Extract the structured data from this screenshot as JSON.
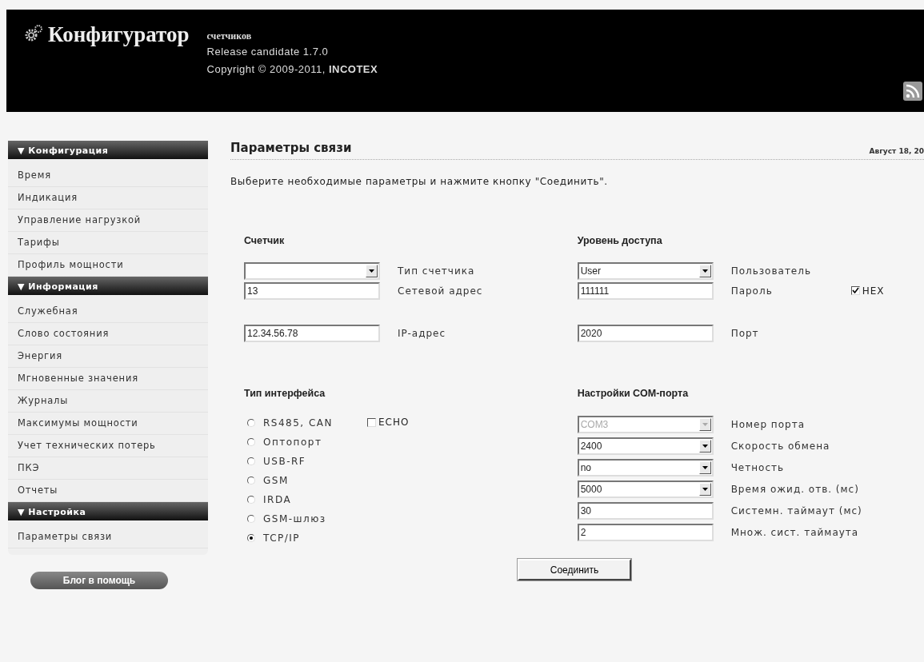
{
  "header": {
    "title": "Конфигуратор",
    "subtitle": "счетчиков",
    "release": "Release candidate 1.7.0",
    "copyright": "Copyright © 2009-2011, **INCOTEX**"
  },
  "sidebar": {
    "sections": [
      {
        "title": "▼ Конфигурация",
        "items": [
          "Время",
          "Индикация",
          "Управление нагрузкой",
          "Тарифы",
          "Профиль мощности"
        ]
      },
      {
        "title": "▼ Информация",
        "items": [
          "Служебная",
          "Слово состояния",
          "Энергия",
          "Мгновенные значения",
          "Журналы",
          "Максимумы мощности",
          "Учет технических потерь",
          "ПКЭ",
          "Отчеты"
        ]
      },
      {
        "title": "▼ Настройка",
        "items": [
          "Параметры связи"
        ]
      }
    ]
  },
  "blog_button": "Блог в помощь",
  "page": {
    "title": "Параметры связи",
    "date": "Август 18, 20",
    "instruction": "Выберите необходимые параметры и нажмите кнопку \"Соединить\"."
  },
  "meter": {
    "title": "Счетчик",
    "fields": [
      {
        "kind": "select",
        "label": "Тип счетчика"
      },
      {
        "kind": "input",
        "value": "13",
        "label": "Сетевой адрес"
      },
      {
        "kind": "input",
        "value": "12.34.56.78",
        "label": "IP-адрес"
      }
    ]
  },
  "access": {
    "title": "Уровень доступа",
    "fields": [
      {
        "kind": "select",
        "value": "User",
        "label": "Пользователь"
      },
      {
        "kind": "input",
        "value": "111111",
        "label": "Пароль"
      },
      {
        "kind": "input",
        "value": "2020",
        "label": "Порт"
      }
    ],
    "hex": {
      "label": "HEX",
      "checked": true
    }
  },
  "interface": {
    "title": "Тип интерфейса",
    "options": [
      {
        "label": "RS485, CAN",
        "selected": false
      },
      {
        "label": "Оптопорт",
        "selected": false
      },
      {
        "label": "USB-RF",
        "selected": false
      },
      {
        "label": "GSM",
        "selected": false
      },
      {
        "label": "IRDA",
        "selected": false
      },
      {
        "label": "GSM-шлюз",
        "selected": false
      },
      {
        "label": "TCP/IP",
        "selected": true
      }
    ],
    "echo": {
      "label": "ECHO",
      "checked": false
    }
  },
  "com": {
    "title": "Настройки COM-порта",
    "fields": [
      {
        "kind": "select",
        "value": "COM3",
        "label": "Номер порта",
        "disabled": true
      },
      {
        "kind": "select",
        "value": "2400",
        "label": "Скорость обмена",
        "disabled": false
      },
      {
        "kind": "select",
        "value": "no",
        "label": "Четность",
        "disabled": false
      },
      {
        "kind": "select",
        "value": "5000",
        "label": "Время ожид. отв. (мс)",
        "disabled": false
      },
      {
        "kind": "input",
        "value": "30",
        "label": "Системн. таймаут (мс)",
        "disabled": false
      },
      {
        "kind": "input",
        "value": "2",
        "label": "Множ. сист. таймаута",
        "disabled": false
      }
    ]
  },
  "connect_button": "Соединить"
}
